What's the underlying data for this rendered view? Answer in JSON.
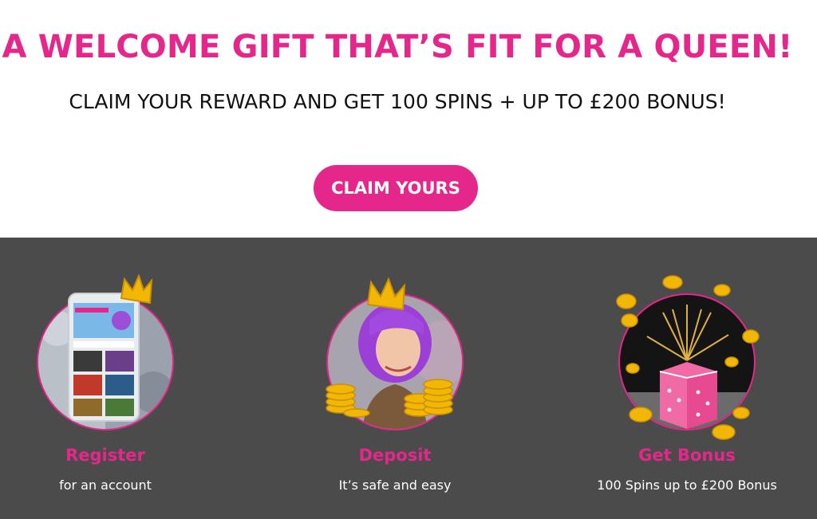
{
  "hero": {
    "headline": "A WELCOME GIFT THAT’S FIT FOR A QUEEN!",
    "subline": "CLAIM YOUR REWARD AND GET 100 SPINS + UP TO £200 BONUS!",
    "cta_label": "CLAIM YOURS"
  },
  "steps": [
    {
      "title": "Register",
      "description": "for an account",
      "image": "phone-with-crown-icon"
    },
    {
      "title": "Deposit",
      "description": "It’s safe and easy",
      "image": "queen-with-coins-icon"
    },
    {
      "title": "Get Bonus",
      "description": "100 Spins up to £200 Bonus",
      "image": "gift-box-with-coins-icon"
    }
  ],
  "colors": {
    "accent": "#e5268a",
    "panel_background": "#4b4b4b",
    "text_dark": "#111111",
    "text_light": "#ffffff",
    "gold": "#f2b705"
  }
}
